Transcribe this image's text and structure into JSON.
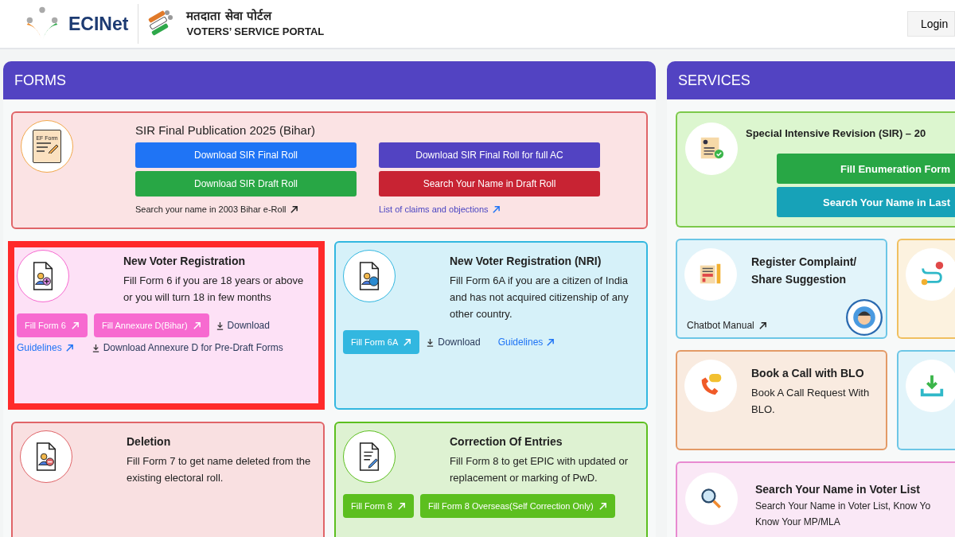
{
  "header": {
    "logo_text": "ECINet",
    "portal_hindi": "मतदाता सेवा पोर्टल",
    "portal_english": "VOTERS’ SERVICE PORTAL",
    "login": "Login"
  },
  "forms": {
    "title": "FORMS",
    "sir": {
      "title": "SIR Final Publication 2025 (Bihar)",
      "icon_label": "EF Form",
      "buttons": [
        {
          "label": "Download SIR Final Roll",
          "color": "#1f74f5"
        },
        {
          "label": "Download SIR Final Roll for full AC",
          "color": "#5243c2"
        },
        {
          "label": "Download SIR Draft Roll",
          "color": "#28a745"
        },
        {
          "label": "Search Your Name in Draft Roll",
          "color": "#c82333"
        }
      ],
      "links": [
        {
          "label": "Search your name in 2003 Bihar e-Roll",
          "kind": "dark"
        },
        {
          "label": "List of claims and objections",
          "kind": "blue"
        }
      ]
    },
    "cards": [
      {
        "title": "New Voter Registration",
        "description": "Fill Form 6 if you are 18 years or above or you will turn 18 in few months",
        "color": "#f76ad0",
        "highlighted": true,
        "actions": [
          {
            "kind": "button",
            "label": "Fill Form 6"
          },
          {
            "kind": "button",
            "label": "Fill Annexure D(Bihar)"
          },
          {
            "kind": "download",
            "label": "Download"
          },
          {
            "kind": "link",
            "label": "Guidelines"
          },
          {
            "kind": "download",
            "label": "Download Annexure D for Pre-Draft Forms"
          }
        ]
      },
      {
        "title": "New Voter Registration (NRI)",
        "description": "Fill Form 6A if you are a citizen of India and has not acquired citizenship of any other country.",
        "color": "#32b7e0",
        "highlighted": false,
        "actions": [
          {
            "kind": "button",
            "label": "Fill Form 6A"
          },
          {
            "kind": "download",
            "label": "Download"
          },
          {
            "kind": "link",
            "label": "Guidelines"
          }
        ]
      },
      {
        "title": "Deletion",
        "description": "Fill Form 7 to get name deleted from the existing electoral roll.",
        "color": "#e06468",
        "highlighted": false
      },
      {
        "title": "Correction Of Entries",
        "description": "Fill Form 8 to get EPIC with updated or replacement or marking of PwD.",
        "color": "#5cbf1f",
        "highlighted": false,
        "actions": [
          {
            "kind": "button",
            "label": "Fill Form 8"
          },
          {
            "kind": "button",
            "label": "Fill Form 8 Overseas(Self Correction Only)"
          }
        ]
      }
    ]
  },
  "services": {
    "title": "SERVICES",
    "sir": {
      "title": "Special Intensive Revision (SIR) – 20",
      "buttons": [
        {
          "label": "Fill Enumeration Form",
          "color": "#28a745"
        },
        {
          "label": "Search Your Name in Last",
          "color": "#17a2b8"
        }
      ]
    },
    "tiles": [
      {
        "title": "Register Complaint/ Share Suggestion",
        "link": "Chatbot Manual",
        "color": "#6cc6e6"
      },
      {
        "color": "#f0c060"
      },
      {
        "title": "Book a Call with BLO",
        "description": "Book A Call Request With BLO.",
        "color": "#e39a66"
      },
      {
        "color": "#6cc6e6"
      }
    ],
    "search": {
      "title": "Search Your Name in Voter List",
      "lines": [
        "Search Your Name in Voter List, Know Yo",
        "Know Your MP/MLA"
      ],
      "color": "#e88ad0"
    }
  }
}
